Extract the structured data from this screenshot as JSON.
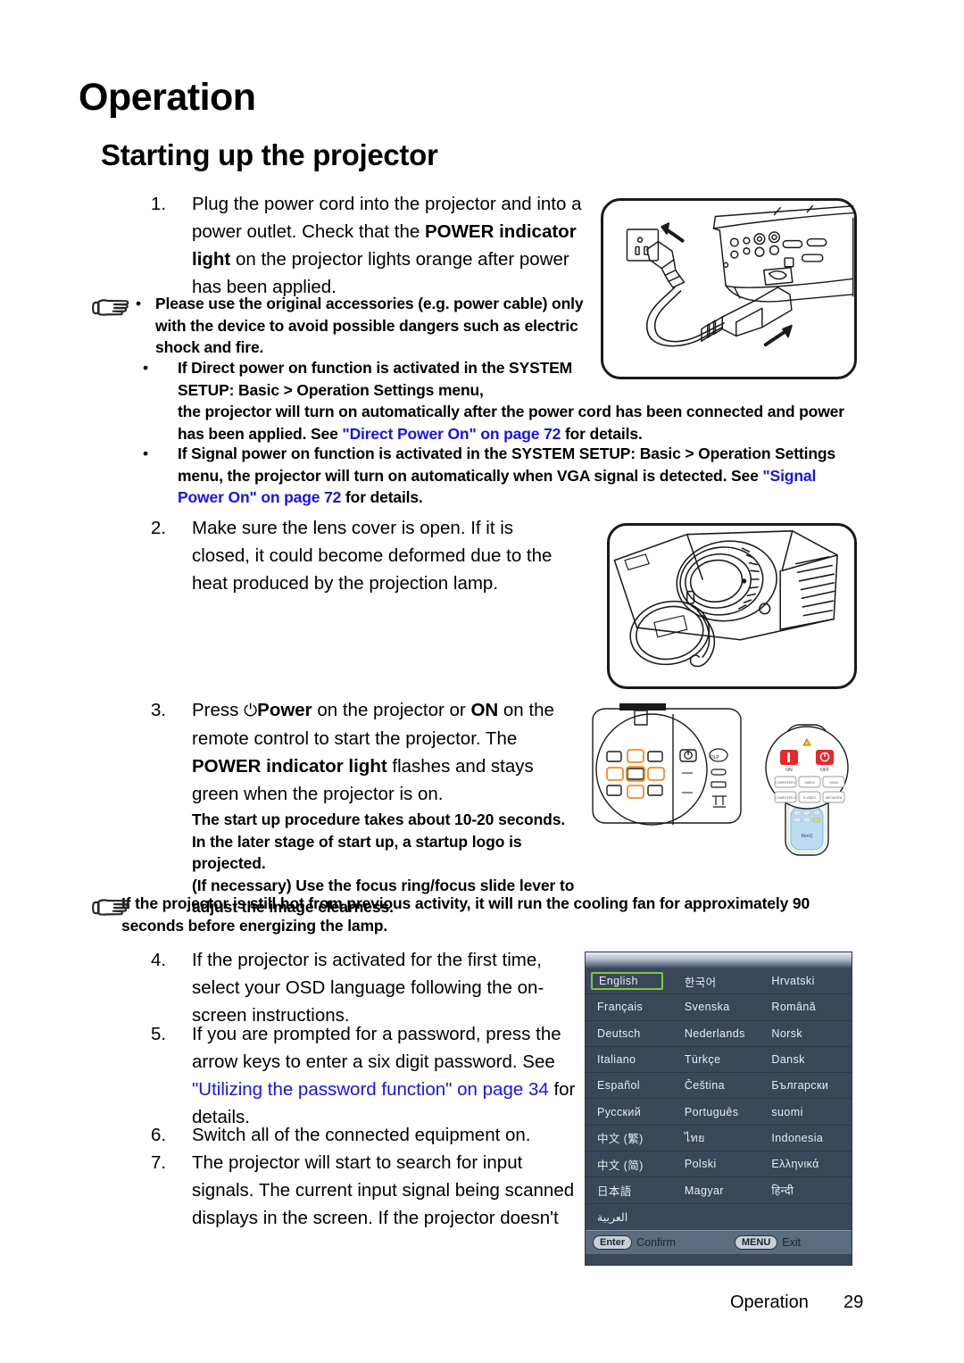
{
  "headings": {
    "chapter": "Operation",
    "section": "Starting up the projector"
  },
  "steps": {
    "s1": {
      "num": "1.",
      "t1": "Plug the power cord into the projector and into a power outlet. Check that the ",
      "b1": "POWER indicator light",
      "t2": " on the projector lights orange after power has been applied."
    },
    "s2": {
      "num": "2.",
      "t1": "Make sure the lens cover is open. If it is closed, it could become deformed due to the heat produced by the projection lamp."
    },
    "s3": {
      "num": "3.",
      "t1": "Press ",
      "icon": "⏻",
      "b1": "Power",
      "t2": " on the projector or ",
      "b2": "ON",
      "t3": " on the remote control to start the projector. The ",
      "b3": "POWER indicator light",
      "t4": " flashes and stays green when the projector is on.",
      "sub1": "The start up procedure takes about 10-20 seconds. In the later stage of start up, a startup logo is projected.",
      "sub2": "(If necessary) Use the focus ring/focus slide lever to adjust the image clearness."
    },
    "s4": {
      "num": "4.",
      "t1": "If the projector is activated for the first time, select your OSD language following the on-screen instructions."
    },
    "s5": {
      "num": "5.",
      "t1": "If you are prompted for a password, press the arrow keys to enter a six digit password. See ",
      "link": "\"Utilizing the password function\" on page 34",
      "t2": " for details."
    },
    "s6": {
      "num": "6.",
      "t1": "Switch all of the connected equipment on."
    },
    "s7": {
      "num": "7.",
      "t1": "The projector will start to search for input signals. The current input signal being scanned displays in the screen. If the projector doesn't"
    }
  },
  "notes": {
    "n1": {
      "icon": "pointing-hand-icon",
      "bullet": "•",
      "text": "Please use the original accessories (e.g. power cable) only with the device to avoid possible dangers such as electric shock and fire."
    },
    "n2": {
      "bullet": "•",
      "t1": "If Direct power on function is activated in the SYSTEM SETUP: Basic > Operation Settings menu,",
      "t2": " the projector will turn on automatically after the power cord has been connected and power has been applied. See ",
      "link": "\"Direct Power On\" on page 72",
      "t3": " for details."
    },
    "n3": {
      "bullet": "•",
      "t1": "If Signal power on function is activated in the SYSTEM SETUP: Basic > Operation Settings menu, the projector will turn on automatically when VGA signal is detected. See ",
      "link": "\"Signal Power On\" on page 72",
      "t2": " for details."
    },
    "n4": {
      "icon": "pointing-hand-icon",
      "text": "If the projector is still hot from previous activity, it will run the cooling fan for approximately 90 seconds before energizing the lamp."
    }
  },
  "osd": {
    "selected": "English",
    "rows": [
      [
        "English",
        "한국어",
        "Hrvatski"
      ],
      [
        "Français",
        "Svenska",
        "Română"
      ],
      [
        "Deutsch",
        "Nederlands",
        "Norsk"
      ],
      [
        "Italiano",
        "Türkçe",
        "Dansk"
      ],
      [
        "Español",
        "Čeština",
        "Български"
      ],
      [
        "Русский",
        "Português",
        "suomi"
      ],
      [
        "中文 (繁)",
        "ไทย",
        "Indonesia"
      ],
      [
        "中文 (简)",
        "Polski",
        "Ελληνικά"
      ],
      [
        "日本語",
        "Magyar",
        "हिन्दी"
      ],
      [
        "العربية",
        "",
        ""
      ]
    ],
    "footer": {
      "enter_key": "Enter",
      "enter_label": "Confirm",
      "menu_key": "MENU",
      "menu_label": "Exit"
    },
    "highlight_color": "#7ac943",
    "background_color": "#3a4758"
  },
  "illustrations": {
    "power_cord": "power-cord-connection-illustration",
    "lens_cover": "projector-lens-cover-illustration",
    "control_panel": "projector-control-panel-illustration",
    "remote": "remote-control-illustration",
    "brand": "BenQ"
  },
  "footer": {
    "label": "Operation",
    "page": "29"
  }
}
